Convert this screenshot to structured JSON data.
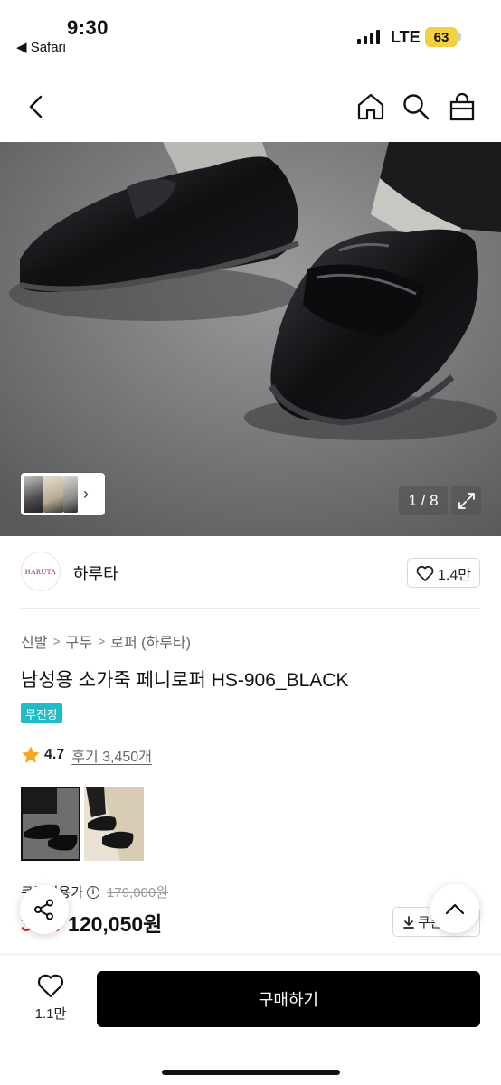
{
  "status_bar": {
    "time": "9:30",
    "back_app": "◀ Safari",
    "network": "LTE",
    "battery": "63"
  },
  "nav": {
    "icons": [
      "chevron-left-icon",
      "home-icon",
      "search-icon",
      "shopping-bag-icon"
    ]
  },
  "gallery": {
    "page_counter": "1 / 8",
    "thumbnail_chevron": "›"
  },
  "brand": {
    "logo_text": "HARUTA",
    "name": "하루타",
    "likes": "1.4만"
  },
  "product": {
    "breadcrumb": [
      "신발",
      "구두",
      "로퍼 (하루타)"
    ],
    "title": "남성용 소가죽 페니로퍼 HS-906_BLACK",
    "badge": "무진장",
    "rating": "4.7",
    "reviews": "후기 3,450개",
    "price_label": "쿠폰적용가",
    "original_price": "179,000원",
    "discount": "33%",
    "sale_price": "120,050원",
    "coupon_label": "쿠폰"
  },
  "bottom_bar": {
    "wish_count": "1.1만",
    "buy_label": "구매하기"
  },
  "colors": {
    "accent_badge": "#21bcc7",
    "discount": "#e0262e",
    "star": "#f5a623",
    "buy_button": "#000000"
  }
}
